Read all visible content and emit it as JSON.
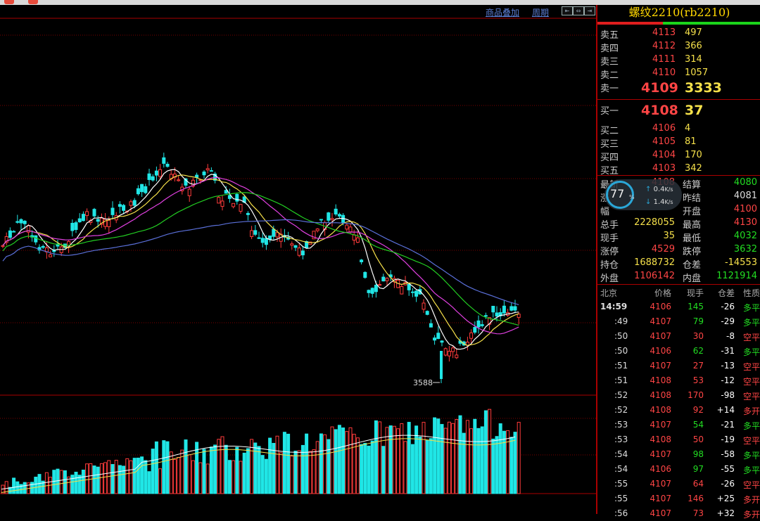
{
  "window": {
    "dots": [
      "#e74c3c",
      "#e74c3c"
    ]
  },
  "toolbar": {
    "overlay_label": "商品叠加",
    "period_label": "周期",
    "nav_buttons": [
      "⇤",
      "⇔",
      "⇥"
    ]
  },
  "chart": {
    "low_label": "3588"
  },
  "quote": {
    "title": "螺纹2210(rb2210)",
    "asks": [
      {
        "label": "卖五",
        "price": "4113",
        "vol": "497"
      },
      {
        "label": "卖四",
        "price": "4112",
        "vol": "366"
      },
      {
        "label": "卖三",
        "price": "4111",
        "vol": "314"
      },
      {
        "label": "卖二",
        "price": "4110",
        "vol": "1057"
      },
      {
        "label": "卖一",
        "price": "4109",
        "vol": "3333"
      }
    ],
    "bids": [
      {
        "label": "买一",
        "price": "4108",
        "vol": "37"
      },
      {
        "label": "买二",
        "price": "4106",
        "vol": "4"
      },
      {
        "label": "买三",
        "price": "4105",
        "vol": "81"
      },
      {
        "label": "买四",
        "price": "4104",
        "vol": "170"
      },
      {
        "label": "买五",
        "price": "4103",
        "vol": "342"
      }
    ],
    "stats": [
      {
        "l1": "最新",
        "v1": "4108",
        "l2": "结算",
        "v2": "4080"
      },
      {
        "l1": "涨",
        "v1": "",
        "l2": "昨结",
        "v2": "4081"
      },
      {
        "l1": "幅",
        "v1": "",
        "l2": "开盘",
        "v2": "4100"
      },
      {
        "l1": "总手",
        "v1": "2228055",
        "l2": "最高",
        "v2": "4130"
      },
      {
        "l1": "现手",
        "v1": "35",
        "l2": "最低",
        "v2": "4032"
      },
      {
        "l1": "涨停",
        "v1": "4529",
        "l2": "跌停",
        "v2": "3632"
      },
      {
        "l1": "持仓",
        "v1": "1688732",
        "l2": "仓差",
        "v2": "-14553"
      },
      {
        "l1": "外盘",
        "v1": "1106142",
        "l2": "内盘",
        "v2": "1121914"
      }
    ],
    "stat_colors": [
      {
        "c1": "#ff4545",
        "c2": "#22dd22"
      },
      {
        "c1": "#ff4545",
        "c2": "#dddddd"
      },
      {
        "c1": "#ff4545",
        "c2": "#ff4545"
      },
      {
        "c1": "#f5e04a",
        "c2": "#ff4545"
      },
      {
        "c1": "#f5e04a",
        "c2": "#22dd22"
      },
      {
        "c1": "#ff4545",
        "c2": "#22dd22"
      },
      {
        "c1": "#f5e04a",
        "c2": "#f5e04a"
      },
      {
        "c1": "#ff4545",
        "c2": "#22dd22"
      }
    ],
    "widget": {
      "percent": "77",
      "sign": "%",
      "up": "0.4",
      "down": "1.4",
      "unit": "K/s"
    },
    "tick_headers": [
      "北京",
      "价格",
      "现手",
      "仓差",
      "性质"
    ],
    "ticks": [
      {
        "t": "14:59",
        "p": "4106",
        "q": "145",
        "d": "-26",
        "n": "多平",
        "pc": "#ff4545",
        "qc": "#22dd22",
        "nc": "#22dd22"
      },
      {
        "t": ":49",
        "p": "4107",
        "q": "79",
        "d": "-29",
        "n": "多平",
        "pc": "#ff4545",
        "qc": "#22dd22",
        "nc": "#22dd22"
      },
      {
        "t": ":50",
        "p": "4107",
        "q": "30",
        "d": "-8",
        "n": "空平",
        "pc": "#ff4545",
        "qc": "#ff4545",
        "nc": "#ff4545"
      },
      {
        "t": ":50",
        "p": "4106",
        "q": "62",
        "d": "-31",
        "n": "多平",
        "pc": "#ff4545",
        "qc": "#22dd22",
        "nc": "#22dd22"
      },
      {
        "t": ":51",
        "p": "4107",
        "q": "27",
        "d": "-13",
        "n": "空平",
        "pc": "#ff4545",
        "qc": "#ff4545",
        "nc": "#ff4545"
      },
      {
        "t": ":51",
        "p": "4108",
        "q": "53",
        "d": "-12",
        "n": "空平",
        "pc": "#ff4545",
        "qc": "#ff4545",
        "nc": "#ff4545"
      },
      {
        "t": ":52",
        "p": "4108",
        "q": "170",
        "d": "-98",
        "n": "空平",
        "pc": "#ff4545",
        "qc": "#ff4545",
        "nc": "#ff4545"
      },
      {
        "t": ":52",
        "p": "4108",
        "q": "92",
        "d": "+14",
        "n": "多开",
        "pc": "#ff4545",
        "qc": "#ff4545",
        "nc": "#ff4545"
      },
      {
        "t": ":53",
        "p": "4107",
        "q": "54",
        "d": "-21",
        "n": "多平",
        "pc": "#ff4545",
        "qc": "#22dd22",
        "nc": "#22dd22"
      },
      {
        "t": ":53",
        "p": "4108",
        "q": "50",
        "d": "-19",
        "n": "空平",
        "pc": "#ff4545",
        "qc": "#ff4545",
        "nc": "#ff4545"
      },
      {
        "t": ":54",
        "p": "4107",
        "q": "98",
        "d": "-58",
        "n": "多平",
        "pc": "#ff4545",
        "qc": "#22dd22",
        "nc": "#22dd22"
      },
      {
        "t": ":54",
        "p": "4106",
        "q": "97",
        "d": "-55",
        "n": "多平",
        "pc": "#ff4545",
        "qc": "#22dd22",
        "nc": "#22dd22"
      },
      {
        "t": ":55",
        "p": "4107",
        "q": "64",
        "d": "-26",
        "n": "空平",
        "pc": "#ff4545",
        "qc": "#ff4545",
        "nc": "#ff4545"
      },
      {
        "t": ":55",
        "p": "4107",
        "q": "146",
        "d": "+25",
        "n": "多开",
        "pc": "#ff4545",
        "qc": "#ff4545",
        "nc": "#ff4545"
      },
      {
        "t": ":56",
        "p": "4107",
        "q": "73",
        "d": "+32",
        "n": "多开",
        "pc": "#ff4545",
        "qc": "#ff4545",
        "nc": "#ff4545"
      }
    ]
  }
}
